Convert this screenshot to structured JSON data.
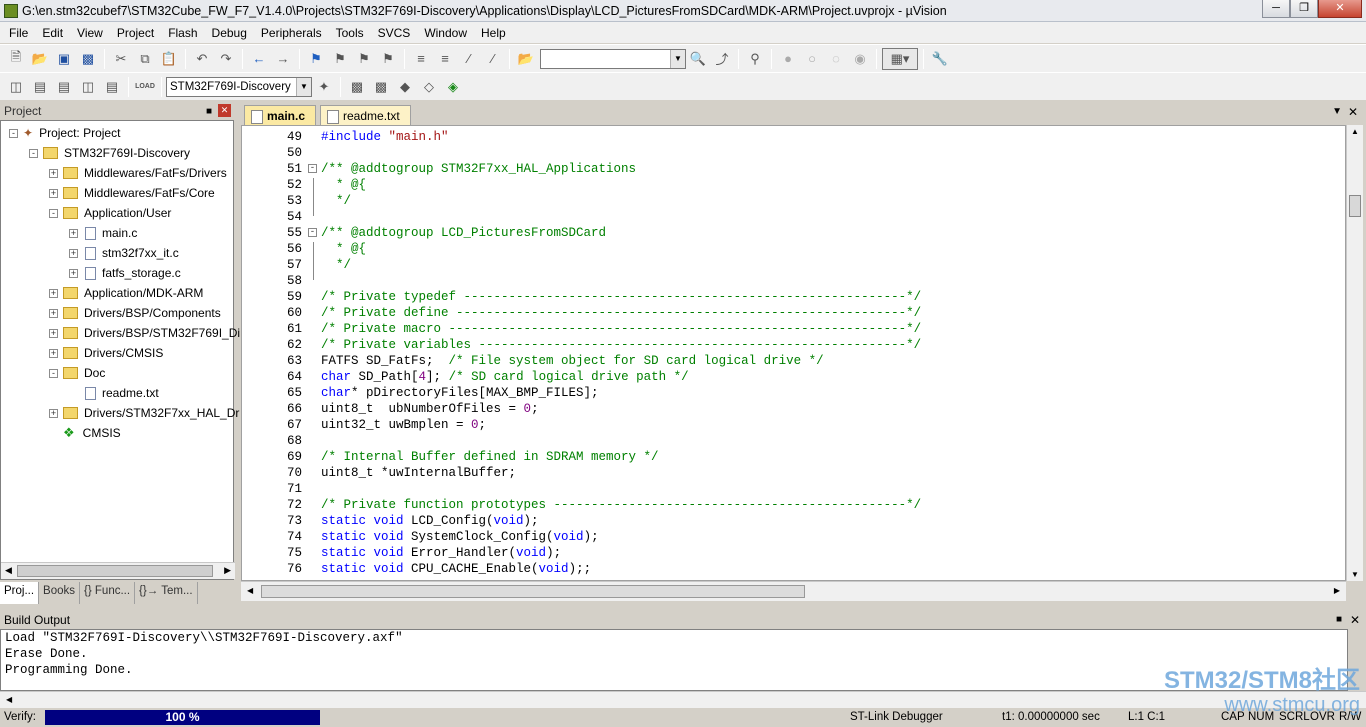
{
  "window": {
    "title": "G:\\en.stm32cubef7\\STM32Cube_FW_F7_V1.4.0\\Projects\\STM32F769I-Discovery\\Applications\\Display\\LCD_PicturesFromSDCard\\MDK-ARM\\Project.uvprojx - µVision"
  },
  "menu": [
    "File",
    "Edit",
    "View",
    "Project",
    "Flash",
    "Debug",
    "Peripherals",
    "Tools",
    "SVCS",
    "Window",
    "Help"
  ],
  "toolbar": {
    "target": "STM32F769I-Discovery",
    "search_value": ""
  },
  "project_panel": {
    "title": "Project",
    "tree": [
      {
        "label": "Project: Project",
        "depth": 0,
        "kind": "root",
        "expander": "-"
      },
      {
        "label": "STM32F769I-Discovery",
        "depth": 1,
        "kind": "target",
        "expander": "-"
      },
      {
        "label": "Middlewares/FatFs/Drivers",
        "depth": 2,
        "kind": "folder",
        "expander": "+"
      },
      {
        "label": "Middlewares/FatFs/Core",
        "depth": 2,
        "kind": "folder",
        "expander": "+"
      },
      {
        "label": "Application/User",
        "depth": 2,
        "kind": "folder",
        "expander": "-"
      },
      {
        "label": "main.c",
        "depth": 3,
        "kind": "file",
        "expander": "+"
      },
      {
        "label": "stm32f7xx_it.c",
        "depth": 3,
        "kind": "file",
        "expander": "+"
      },
      {
        "label": "fatfs_storage.c",
        "depth": 3,
        "kind": "file",
        "expander": "+"
      },
      {
        "label": "Application/MDK-ARM",
        "depth": 2,
        "kind": "folder",
        "expander": "+"
      },
      {
        "label": "Drivers/BSP/Components",
        "depth": 2,
        "kind": "folder",
        "expander": "+"
      },
      {
        "label": "Drivers/BSP/STM32F769I_Di",
        "depth": 2,
        "kind": "folder",
        "expander": "+"
      },
      {
        "label": "Drivers/CMSIS",
        "depth": 2,
        "kind": "folder",
        "expander": "+"
      },
      {
        "label": "Doc",
        "depth": 2,
        "kind": "folder",
        "expander": "-"
      },
      {
        "label": "readme.txt",
        "depth": 3,
        "kind": "file",
        "expander": ""
      },
      {
        "label": "Drivers/STM32F7xx_HAL_Dr",
        "depth": 2,
        "kind": "folder",
        "expander": "+"
      },
      {
        "label": "CMSIS",
        "depth": 2,
        "kind": "component",
        "expander": ""
      }
    ],
    "tabs": [
      "Proj...",
      "Books",
      "{} Func...",
      "{}→ Tem..."
    ]
  },
  "editor": {
    "tabs": [
      "main.c",
      "readme.txt"
    ],
    "active_tab": "main.c",
    "lines": [
      {
        "n": "49",
        "fold": "",
        "segs": [
          [
            "pp",
            "#include "
          ],
          [
            "str",
            "\"main.h\""
          ]
        ]
      },
      {
        "n": "50",
        "fold": "",
        "segs": []
      },
      {
        "n": "51",
        "fold": "-",
        "segs": [
          [
            "cm",
            "/** @addtogroup STM32F7xx_HAL_Applications"
          ]
        ]
      },
      {
        "n": "52",
        "fold": "",
        "segs": [
          [
            "cm",
            "  * @{"
          ]
        ]
      },
      {
        "n": "53",
        "fold": "",
        "segs": [
          [
            "cm",
            "  */"
          ]
        ]
      },
      {
        "n": "54",
        "fold": "",
        "segs": []
      },
      {
        "n": "55",
        "fold": "-",
        "segs": [
          [
            "cm",
            "/** @addtogroup LCD_PicturesFromSDCard"
          ]
        ]
      },
      {
        "n": "56",
        "fold": "",
        "segs": [
          [
            "cm",
            "  * @{"
          ]
        ]
      },
      {
        "n": "57",
        "fold": "",
        "segs": [
          [
            "cm",
            "  */"
          ]
        ]
      },
      {
        "n": "58",
        "fold": "",
        "segs": []
      },
      {
        "n": "59",
        "fold": "",
        "segs": [
          [
            "cm",
            "/* Private typedef -----------------------------------------------------------*/"
          ]
        ]
      },
      {
        "n": "60",
        "fold": "",
        "segs": [
          [
            "cm",
            "/* Private define ------------------------------------------------------------*/"
          ]
        ]
      },
      {
        "n": "61",
        "fold": "",
        "segs": [
          [
            "cm",
            "/* Private macro -------------------------------------------------------------*/"
          ]
        ]
      },
      {
        "n": "62",
        "fold": "",
        "segs": [
          [
            "cm",
            "/* Private variables ---------------------------------------------------------*/"
          ]
        ]
      },
      {
        "n": "63",
        "fold": "",
        "segs": [
          [
            "pl",
            "FATFS SD_FatFs;  "
          ],
          [
            "cm",
            "/* File system object for SD card logical drive */"
          ]
        ]
      },
      {
        "n": "64",
        "fold": "",
        "segs": [
          [
            "kw",
            "char"
          ],
          [
            "pl",
            " SD_Path["
          ],
          [
            "num",
            "4"
          ],
          [
            "pl",
            "]; "
          ],
          [
            "cm",
            "/* SD card logical drive path */"
          ]
        ]
      },
      {
        "n": "65",
        "fold": "",
        "segs": [
          [
            "kw",
            "char"
          ],
          [
            "pl",
            "* pDirectoryFiles[MAX_BMP_FILES];"
          ]
        ]
      },
      {
        "n": "66",
        "fold": "",
        "segs": [
          [
            "pl",
            "uint8_t  ubNumberOfFiles = "
          ],
          [
            "num",
            "0"
          ],
          [
            "pl",
            ";"
          ]
        ]
      },
      {
        "n": "67",
        "fold": "",
        "segs": [
          [
            "pl",
            "uint32_t uwBmplen = "
          ],
          [
            "num",
            "0"
          ],
          [
            "pl",
            ";"
          ]
        ]
      },
      {
        "n": "68",
        "fold": "",
        "segs": []
      },
      {
        "n": "69",
        "fold": "",
        "segs": [
          [
            "cm",
            "/* Internal Buffer defined in SDRAM memory */"
          ]
        ]
      },
      {
        "n": "70",
        "fold": "",
        "segs": [
          [
            "pl",
            "uint8_t *uwInternalBuffer;"
          ]
        ]
      },
      {
        "n": "71",
        "fold": "",
        "segs": []
      },
      {
        "n": "72",
        "fold": "",
        "segs": [
          [
            "cm",
            "/* Private function prototypes -----------------------------------------------*/"
          ]
        ]
      },
      {
        "n": "73",
        "fold": "",
        "segs": [
          [
            "kw",
            "static void"
          ],
          [
            "pl",
            " LCD_Config("
          ],
          [
            "kw",
            "void"
          ],
          [
            "pl",
            ");"
          ]
        ]
      },
      {
        "n": "74",
        "fold": "",
        "segs": [
          [
            "kw",
            "static void"
          ],
          [
            "pl",
            " SystemClock_Config("
          ],
          [
            "kw",
            "void"
          ],
          [
            "pl",
            ");"
          ]
        ]
      },
      {
        "n": "75",
        "fold": "",
        "segs": [
          [
            "kw",
            "static void"
          ],
          [
            "pl",
            " Error_Handler("
          ],
          [
            "kw",
            "void"
          ],
          [
            "pl",
            ");"
          ]
        ]
      },
      {
        "n": "76",
        "fold": "",
        "segs": [
          [
            "kw",
            "static void"
          ],
          [
            "pl",
            " CPU_CACHE_Enable("
          ],
          [
            "kw",
            "void"
          ],
          [
            "pl",
            ");;"
          ]
        ]
      }
    ]
  },
  "build_output": {
    "title": "Build Output",
    "lines": [
      "Load \"STM32F769I-Discovery\\\\STM32F769I-Discovery.axf\"",
      "Erase Done.",
      "Programming Done."
    ]
  },
  "status": {
    "verify_label": "Verify:",
    "progress_text": "100 %",
    "progress": 1.0,
    "debugger": "ST-Link Debugger",
    "time": "t1: 0.00000000 sec",
    "cursor": "L:1 C:1",
    "caps": "CAP",
    "num": "NUM",
    "scrl": "SCRL",
    "ovr": "OVR",
    "rw": "R/W"
  },
  "watermark": {
    "line1": "STM32/STM8社区",
    "line2": "www.stmcu.org"
  }
}
